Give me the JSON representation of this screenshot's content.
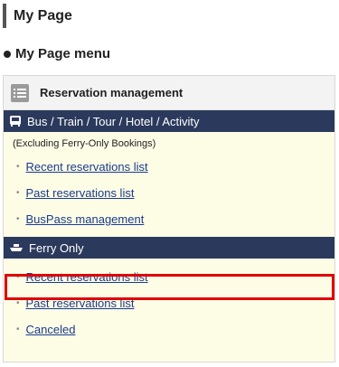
{
  "page": {
    "title": "My Page"
  },
  "menu": {
    "heading": "My Page menu"
  },
  "reservation": {
    "title": "Reservation management",
    "icon": "list-icon",
    "bus_section": {
      "label": "Bus / Train / Tour / Hotel / Activity",
      "icon": "bus-icon",
      "note": "(Excluding Ferry-Only Bookings)",
      "links": [
        "Recent reservations list",
        "Past reservations list",
        "BusPass management"
      ]
    },
    "ferry_section": {
      "label": "Ferry Only",
      "icon": "ferry-icon",
      "links": [
        "Recent reservations list",
        "Past reservations list",
        "Canceled"
      ]
    }
  },
  "colors": {
    "category_bar": "#2b3a5c",
    "panel_bg": "#fdfde6",
    "link": "#1a3a8c",
    "highlight": "#e00000"
  }
}
